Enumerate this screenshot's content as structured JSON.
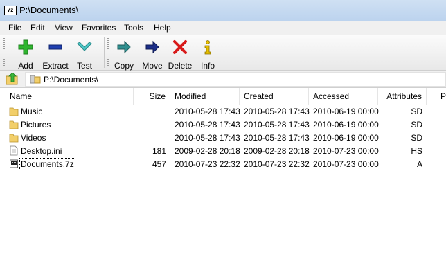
{
  "window": {
    "title": "P:\\Documents\\",
    "app_icon_text": "7z"
  },
  "menu": [
    "File",
    "Edit",
    "View",
    "Favorites",
    "Tools",
    "Help"
  ],
  "toolbar": {
    "add": "Add",
    "extract": "Extract",
    "test": "Test",
    "copy": "Copy",
    "move": "Move",
    "delete": "Delete",
    "info": "Info"
  },
  "address": {
    "path": "P:\\Documents\\"
  },
  "columns": {
    "name": "Name",
    "size": "Size",
    "modified": "Modified",
    "created": "Created",
    "accessed": "Accessed",
    "attributes": "Attributes",
    "extra": "P"
  },
  "files": [
    {
      "name": "Music",
      "icon": "folder-icon",
      "size": "",
      "modified": "2010-05-28 17:43",
      "created": "2010-05-28 17:43",
      "accessed": "2010-06-19 00:00",
      "attributes": "SD"
    },
    {
      "name": "Pictures",
      "icon": "folder-icon",
      "size": "",
      "modified": "2010-05-28 17:43",
      "created": "2010-05-28 17:43",
      "accessed": "2010-06-19 00:00",
      "attributes": "SD"
    },
    {
      "name": "Videos",
      "icon": "folder-icon",
      "size": "",
      "modified": "2010-05-28 17:43",
      "created": "2010-05-28 17:43",
      "accessed": "2010-06-19 00:00",
      "attributes": "SD"
    },
    {
      "name": "Desktop.ini",
      "icon": "ini-file-icon",
      "size": "181",
      "modified": "2009-02-28 20:18",
      "created": "2009-02-28 20:18",
      "accessed": "2010-07-23 00:00",
      "attributes": "HS"
    },
    {
      "name": "Documents.7z",
      "icon": "archive-file-icon",
      "size": "457",
      "modified": "2010-07-23 22:32",
      "created": "2010-07-23 22:32",
      "accessed": "2010-07-23 00:00",
      "attributes": "A"
    }
  ],
  "colors": {
    "add_green": "#2fb52f",
    "extract_blue": "#1f3fb0",
    "test_teal": "#4fc8c8",
    "copy_teal": "#2f8f8f",
    "move_navy": "#1c2f8a",
    "delete_red": "#d81a1a",
    "info_yellow": "#e8c000",
    "folder": "#f2cf6a"
  }
}
